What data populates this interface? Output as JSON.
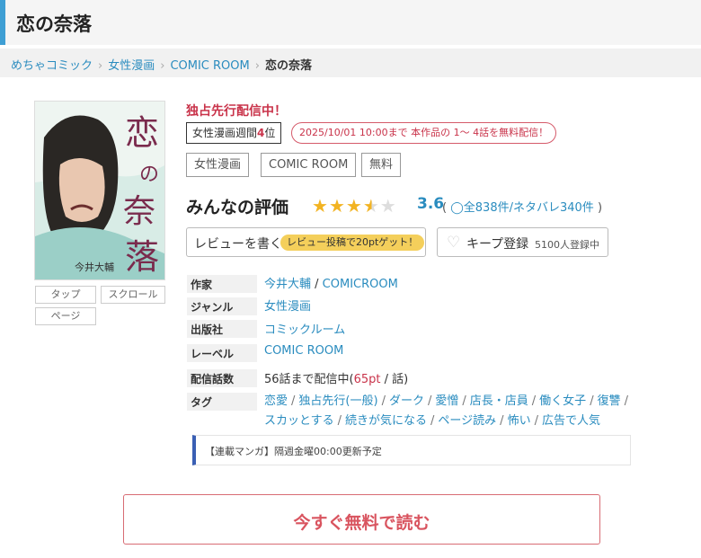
{
  "page": {
    "title": "恋の奈落"
  },
  "breadcrumb": {
    "items": [
      "めちゃコミック",
      "女性漫画",
      "COMIC ROOM"
    ],
    "current": "恋の奈落"
  },
  "cover": {
    "title_chars": [
      "恋",
      "の",
      "奈",
      "落"
    ],
    "author_text": "今井大輔",
    "buttons": [
      "タップ",
      "スクロール",
      "ページ"
    ]
  },
  "badges": {
    "exclusive": "独占先行配信中！",
    "rank_label": "女性漫画週間",
    "rank_num": "4",
    "rank_suffix": "位",
    "free_notice": "2025/10/01 10:00まで 本作品の 1～ 4話を無料配信！"
  },
  "tags_row": [
    "女性漫画",
    "COMIC ROOM",
    "無料"
  ],
  "rating": {
    "label": "みんなの評価",
    "score": "3.6",
    "stars_value": 3.6,
    "open_paren": "(",
    "reviews": "全838件/ネタバレ340件",
    "close_paren": ")"
  },
  "actions": {
    "review_label": "レビューを書く",
    "review_promo": "レビュー投稿で20ptゲット！",
    "keep_label": "キープ登録",
    "keep_count": "5100人登録中"
  },
  "info": {
    "author": {
      "label": "作家",
      "value": "今井大輔",
      "value2": "COMICROOM"
    },
    "genre": {
      "label": "ジャンル",
      "value": "女性漫画"
    },
    "publisher": {
      "label": "出版社",
      "value": "コミックルーム"
    },
    "label_row": {
      "label": "レーベル",
      "value": "COMIC ROOM"
    },
    "episodes": {
      "label": "配信話数",
      "prefix": "56話まで配信中(",
      "price": "65pt",
      "suffix": " / 話)"
    },
    "tags": {
      "label": "タグ",
      "line1": [
        "恋愛",
        "独占先行(一般)",
        "ダーク",
        "愛憎",
        "店長・店員",
        "働く女子",
        "復讐"
      ],
      "line2": [
        "スカッとする",
        "続きが気になる",
        "ページ読み",
        "怖い",
        "広告で人気"
      ]
    }
  },
  "notice": "【連載マンガ】隔週金曜00:00更新予定",
  "cta": {
    "label": "今すぐ無料で読む"
  },
  "colors": {
    "accent_blue": "#3f9fd4",
    "link": "#2a8cbf",
    "red": "#c9334a",
    "star": "#f2b322"
  }
}
